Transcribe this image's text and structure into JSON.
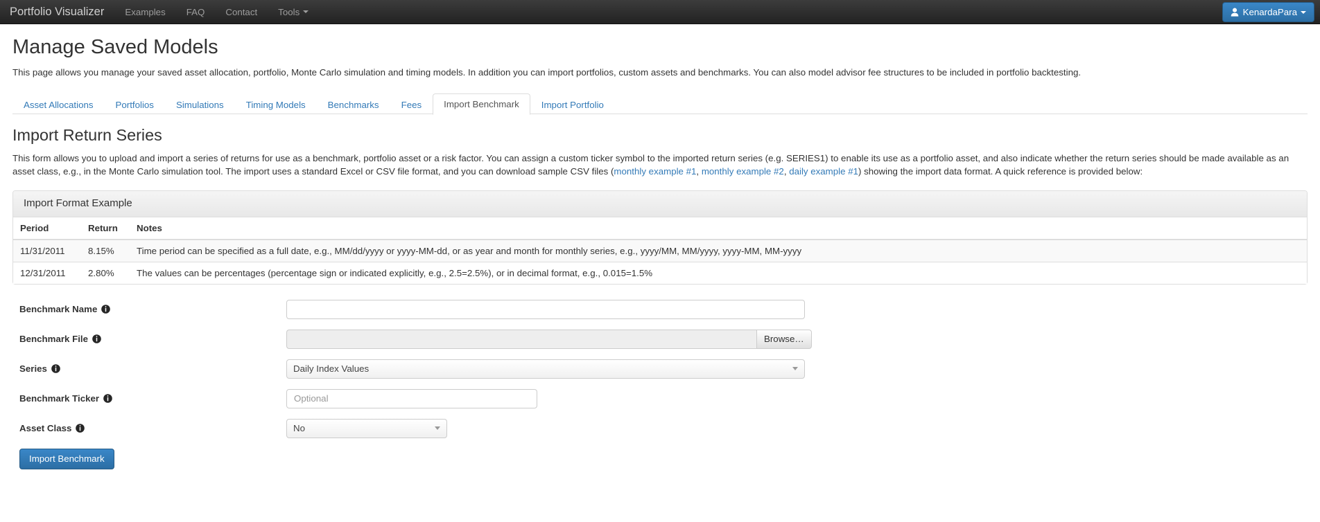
{
  "navbar": {
    "brand": "Portfolio Visualizer",
    "links": [
      {
        "label": "Examples",
        "icon": "",
        "has_caret": false
      },
      {
        "label": "FAQ",
        "icon": "",
        "has_caret": false
      },
      {
        "label": "Contact",
        "icon": "",
        "has_caret": false
      },
      {
        "label": "Tools",
        "icon": "chevron-down-icon",
        "has_caret": true
      }
    ],
    "user": {
      "label": "KenardaPara",
      "icon": "user-icon",
      "caret_icon": "chevron-down-icon",
      "color": "#2f76ad"
    }
  },
  "page": {
    "title": "Manage Saved Models",
    "description": "This page allows you manage your saved asset allocation, portfolio, Monte Carlo simulation and timing models. In addition you can import portfolios, custom assets and benchmarks. You can also model advisor fee structures to be included in portfolio backtesting."
  },
  "tabs": [
    {
      "label": "Asset Allocations",
      "active": false
    },
    {
      "label": "Portfolios",
      "active": false
    },
    {
      "label": "Simulations",
      "active": false
    },
    {
      "label": "Timing Models",
      "active": false
    },
    {
      "label": "Benchmarks",
      "active": false
    },
    {
      "label": "Fees",
      "active": false
    },
    {
      "label": "Import Benchmark",
      "active": true
    },
    {
      "label": "Import Portfolio",
      "active": false
    }
  ],
  "section": {
    "title": "Import Return Series",
    "desc_part1": "This form allows you to upload and import a series of returns for use as a benchmark, portfolio asset or a risk factor. You can assign a custom ticker symbol to the imported return series (e.g. SERIES1) to enable its use as a portfolio asset, and also indicate whether the return series should be made available as an asset class, e.g., in the Monte Carlo simulation tool. The import uses a standard Excel or CSV file format, and you can download sample CSV files (",
    "link1": "monthly example #1",
    "sep1": ", ",
    "link2": "monthly example #2",
    "sep2": ", ",
    "link3": "daily example #1",
    "desc_part2": ") showing the import data format. A quick reference is provided below:"
  },
  "format_panel": {
    "heading": "Import Format Example",
    "columns": [
      "Period",
      "Return",
      "Notes"
    ],
    "rows": [
      {
        "period": "11/31/2011",
        "return": "8.15%",
        "notes": "Time period can be specified as a full date, e.g., MM/dd/yyyy or yyyy-MM-dd, or as year and month for monthly series, e.g., yyyy/MM, MM/yyyy, yyyy-MM, MM-yyyy"
      },
      {
        "period": "12/31/2011",
        "return": "2.80%",
        "notes": "The values can be percentages (percentage sign or indicated explicitly, e.g., 2.5=2.5%), or in decimal format, e.g., 0.015=1.5%"
      }
    ]
  },
  "form": {
    "benchmark_name": {
      "label": "Benchmark Name",
      "info_icon": "info-circle-icon",
      "value": "",
      "placeholder": ""
    },
    "benchmark_file": {
      "label": "Benchmark File",
      "info_icon": "info-circle-icon",
      "value": "",
      "browse_label": "Browse…"
    },
    "series": {
      "label": "Series",
      "info_icon": "info-circle-icon",
      "value": "Daily Index Values",
      "caret_icon": "chevron-down-icon"
    },
    "benchmark_ticker": {
      "label": "Benchmark Ticker",
      "info_icon": "info-circle-icon",
      "value": "",
      "placeholder": "Optional"
    },
    "asset_class": {
      "label": "Asset Class",
      "info_icon": "info-circle-icon",
      "value": "No",
      "caret_icon": "chevron-down-icon"
    },
    "submit_label": "Import Benchmark"
  }
}
